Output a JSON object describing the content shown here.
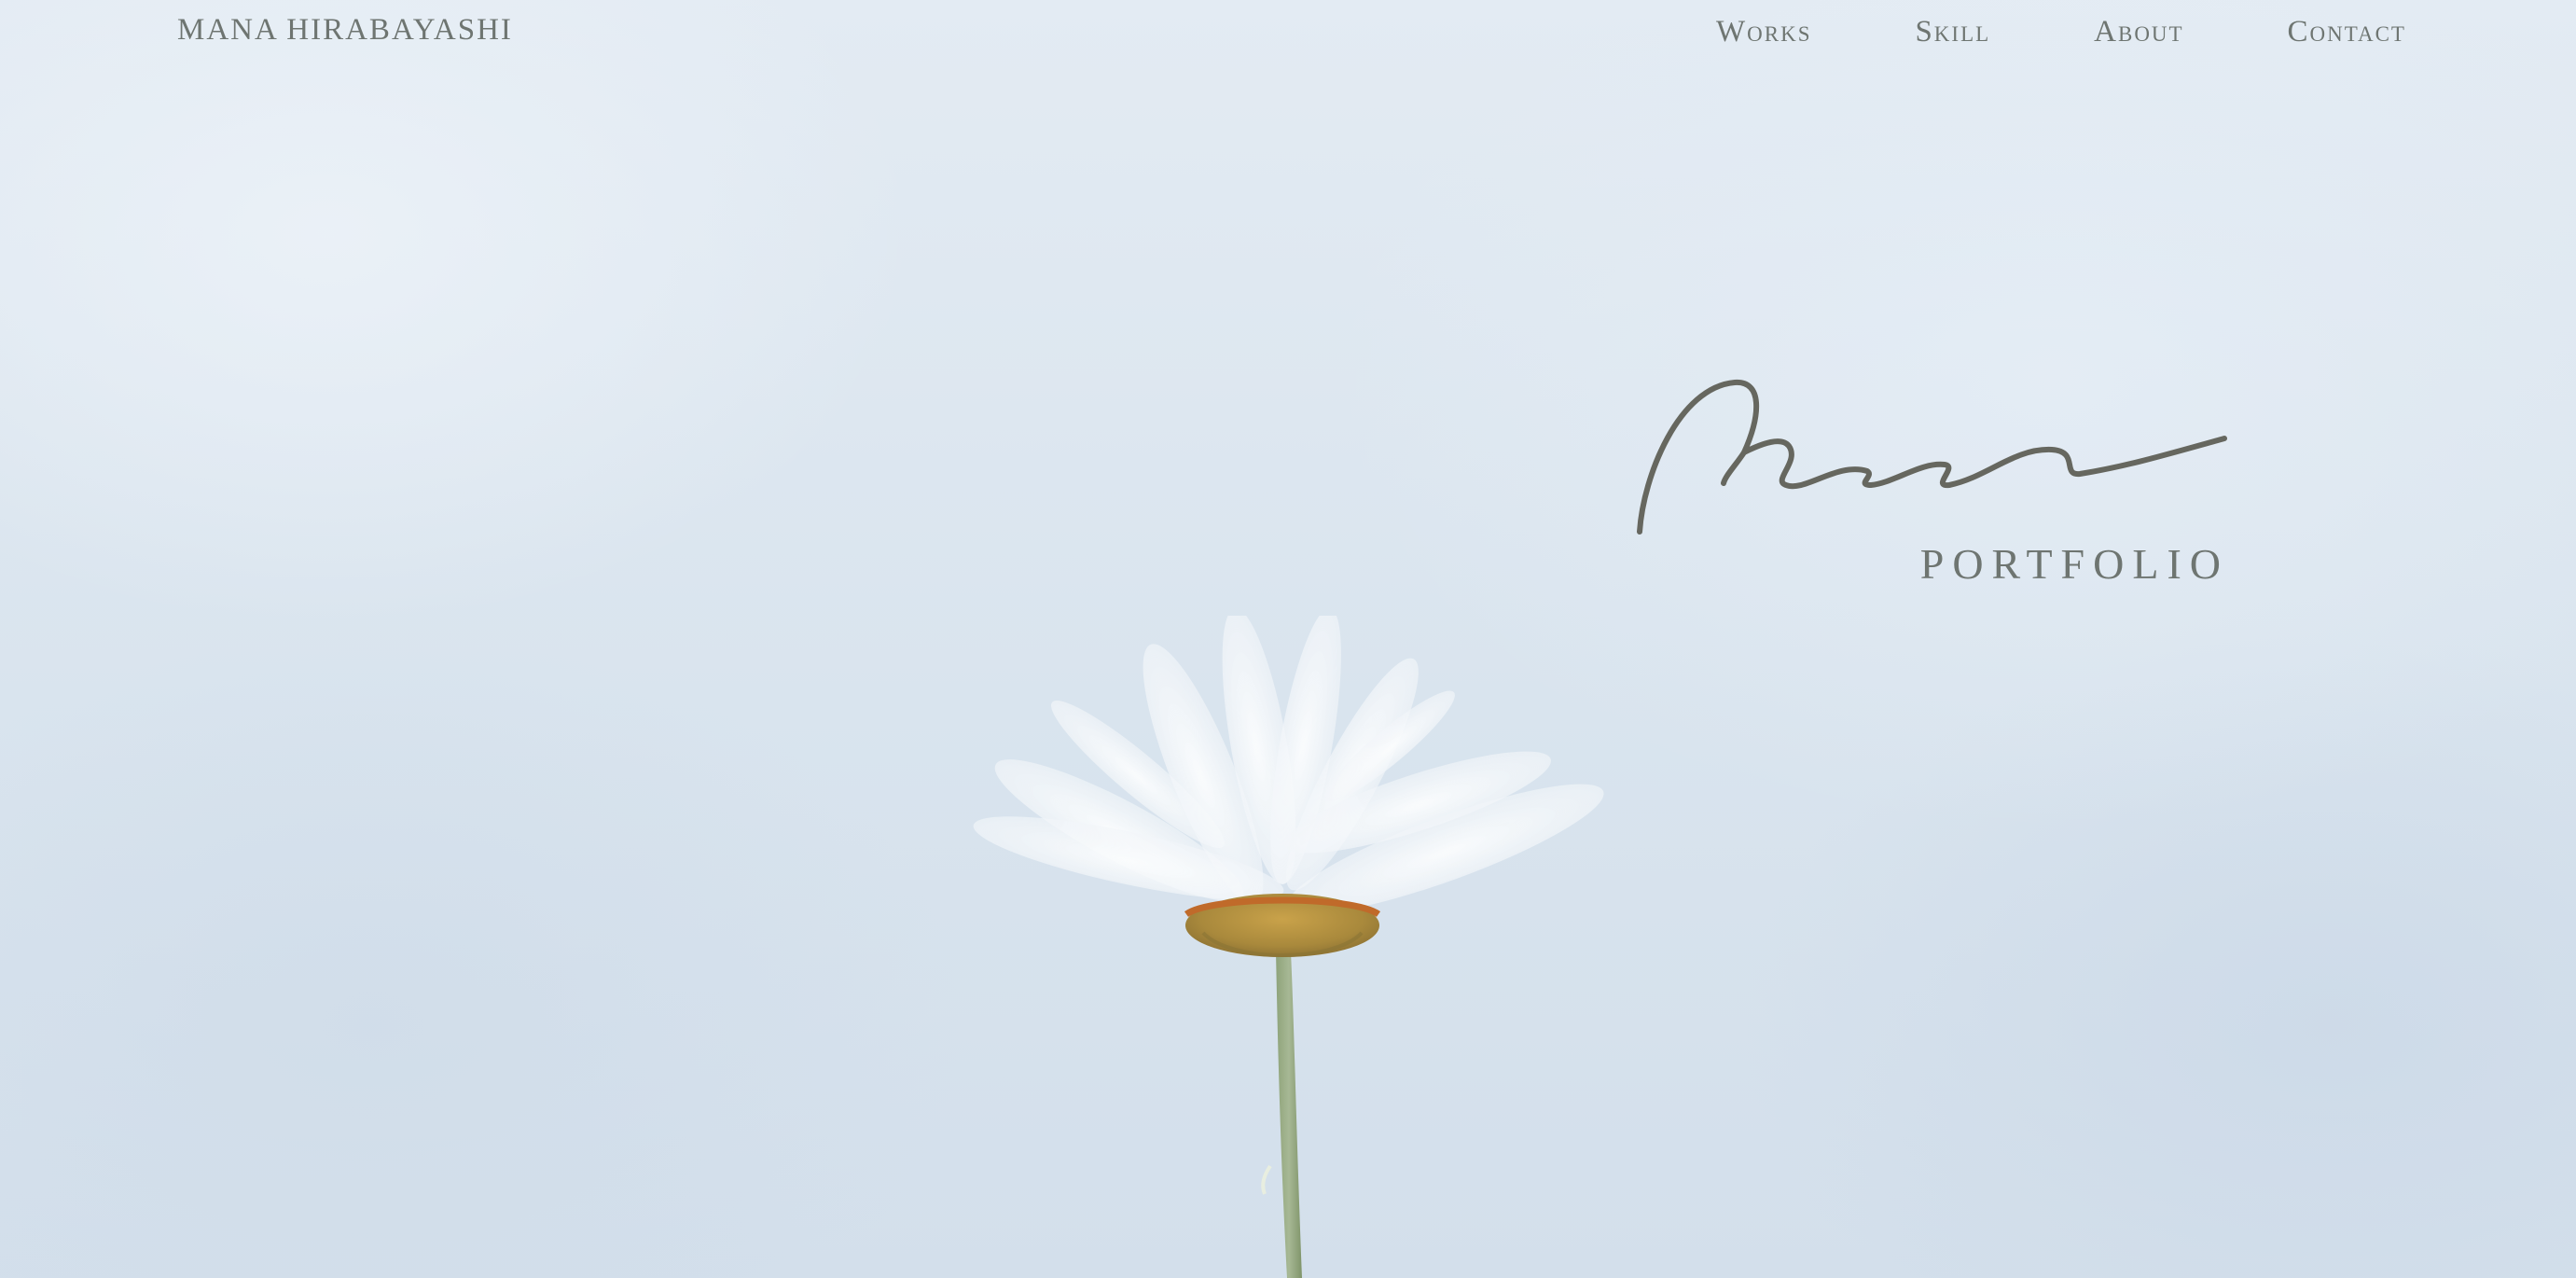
{
  "header": {
    "site_name": "MANA HIRABAYASHI",
    "nav": [
      {
        "label": "Works"
      },
      {
        "label": "Skill"
      },
      {
        "label": "About"
      },
      {
        "label": "Contact"
      }
    ]
  },
  "hero": {
    "signature_text": "mana",
    "subtitle": "PORTFOLIO",
    "image": "white-daisy-photo"
  },
  "colors": {
    "text": "#6e7571",
    "signature_stroke": "#66675f",
    "background": "#dde7f0"
  }
}
